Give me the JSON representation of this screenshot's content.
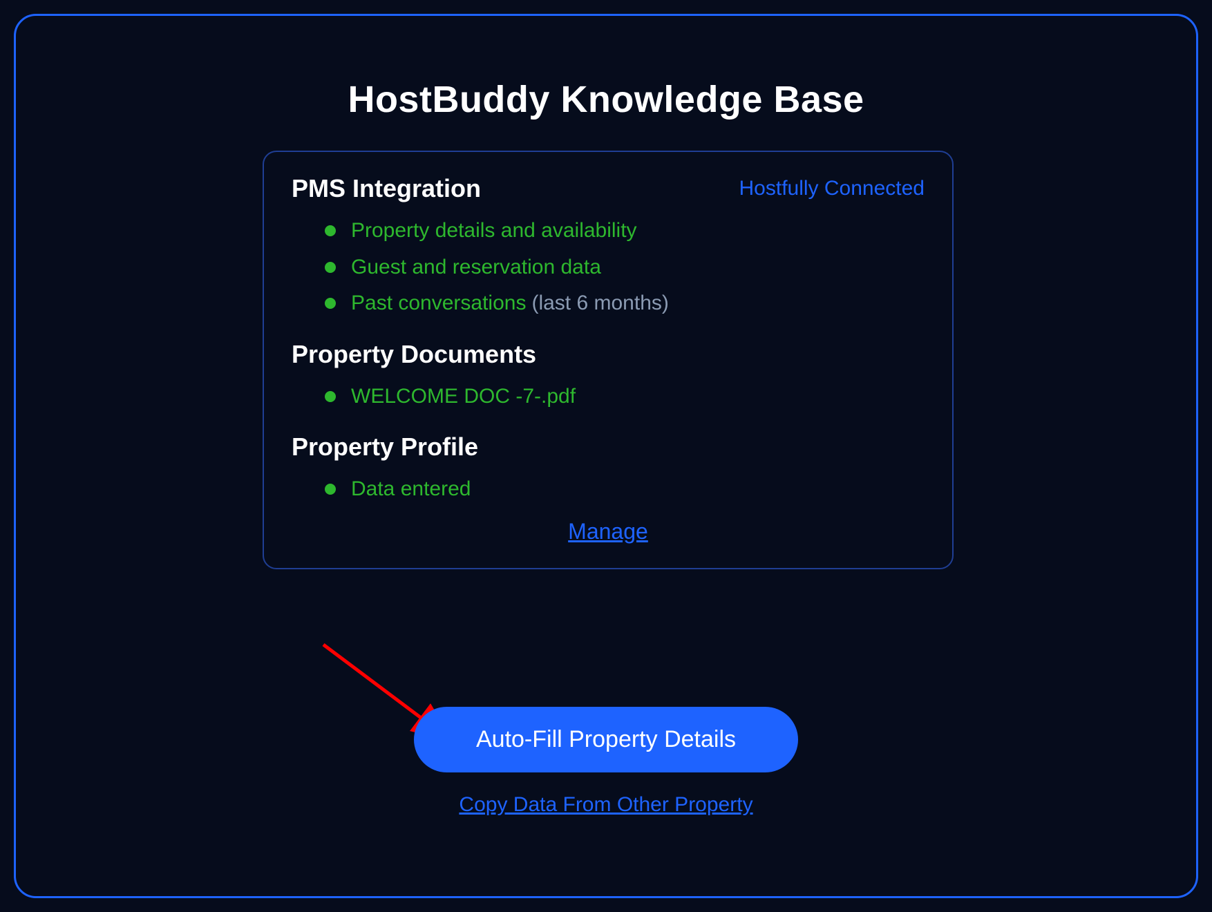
{
  "title": "HostBuddy Knowledge Base",
  "card": {
    "pms": {
      "heading": "PMS Integration",
      "status": "Hostfully Connected",
      "items": [
        {
          "label": "Property details and availability",
          "suffix": ""
        },
        {
          "label": "Guest and reservation data",
          "suffix": ""
        },
        {
          "label": "Past conversations",
          "suffix": "(last 6 months)"
        }
      ]
    },
    "docs": {
      "heading": "Property Documents",
      "items": [
        {
          "label": "WELCOME DOC -7-.pdf",
          "suffix": ""
        }
      ]
    },
    "profile": {
      "heading": "Property Profile",
      "items": [
        {
          "label": "Data entered",
          "suffix": ""
        }
      ]
    },
    "manage": "Manage"
  },
  "cta": {
    "primary": "Auto-Fill Property Details",
    "copy": "Copy Data From Other Property"
  },
  "colors": {
    "accent": "#1e63ff",
    "success": "#2eb82e",
    "muted": "#8b9bb3",
    "bg": "#060c1c"
  }
}
